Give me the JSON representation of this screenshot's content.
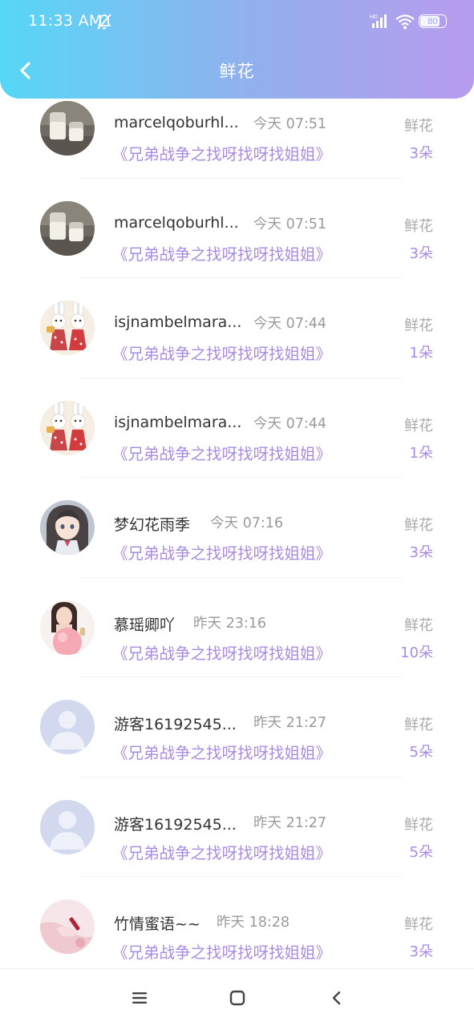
{
  "status_bar": {
    "time": "11:33 AM",
    "battery": "80",
    "battery_fraction": 0.8,
    "icons": [
      "mute-icon",
      "signal-icon",
      "wifi-icon",
      "battery-icon"
    ]
  },
  "header": {
    "title": "鲜花",
    "back_icon": "chevron-left-icon",
    "gradient": [
      "#56d7f6",
      "#b89bee"
    ]
  },
  "colors": {
    "accent": "#a98be4",
    "name": "#333333",
    "muted": "#9a9a9a"
  },
  "items": [
    {
      "name": "marcelqoburhl...",
      "time": "今天 07:51",
      "book": "《兄弟战争之找呀找呀找姐姐》",
      "gift": "鲜花",
      "count": "3朵",
      "avatar": "milk-glasses"
    },
    {
      "name": "marcelqoburhl...",
      "time": "今天 07:51",
      "book": "《兄弟战争之找呀找呀找姐姐》",
      "gift": "鲜花",
      "count": "3朵",
      "avatar": "milk-glasses"
    },
    {
      "name": "isjnambelmara...",
      "time": "今天 07:44",
      "book": "《兄弟战争之找呀找呀找姐姐》",
      "gift": "鲜花",
      "count": "1朵",
      "avatar": "bunny-dolls"
    },
    {
      "name": "isjnambelmara...",
      "time": "今天 07:44",
      "book": "《兄弟战争之找呀找呀找姐姐》",
      "gift": "鲜花",
      "count": "1朵",
      "avatar": "bunny-dolls"
    },
    {
      "name": "梦幻花雨季",
      "time": "今天 07:16",
      "book": "《兄弟战争之找呀找呀找姐姐》",
      "gift": "鲜花",
      "count": "3朵",
      "avatar": "anime-girl"
    },
    {
      "name": "慕瑶卿吖",
      "time": "昨天 23:16",
      "book": "《兄弟战争之找呀找呀找姐姐》",
      "gift": "鲜花",
      "count": "10朵",
      "avatar": "girl-balloon"
    },
    {
      "name": "游客16192545...",
      "time": "昨天 21:27",
      "book": "《兄弟战争之找呀找呀找姐姐》",
      "gift": "鲜花",
      "count": "5朵",
      "avatar": "default-user"
    },
    {
      "name": "游客16192545...",
      "time": "昨天 21:27",
      "book": "《兄弟战争之找呀找呀找姐姐》",
      "gift": "鲜花",
      "count": "5朵",
      "avatar": "default-user"
    },
    {
      "name": "竹情蜜语~~",
      "time": "昨天 18:28",
      "book": "《兄弟战争之找呀找呀找姐姐》",
      "gift": "鲜花",
      "count": "3朵",
      "avatar": "pink-hand"
    }
  ],
  "nav_bar": {
    "buttons": [
      "menu-icon",
      "home-icon",
      "back-icon"
    ]
  }
}
